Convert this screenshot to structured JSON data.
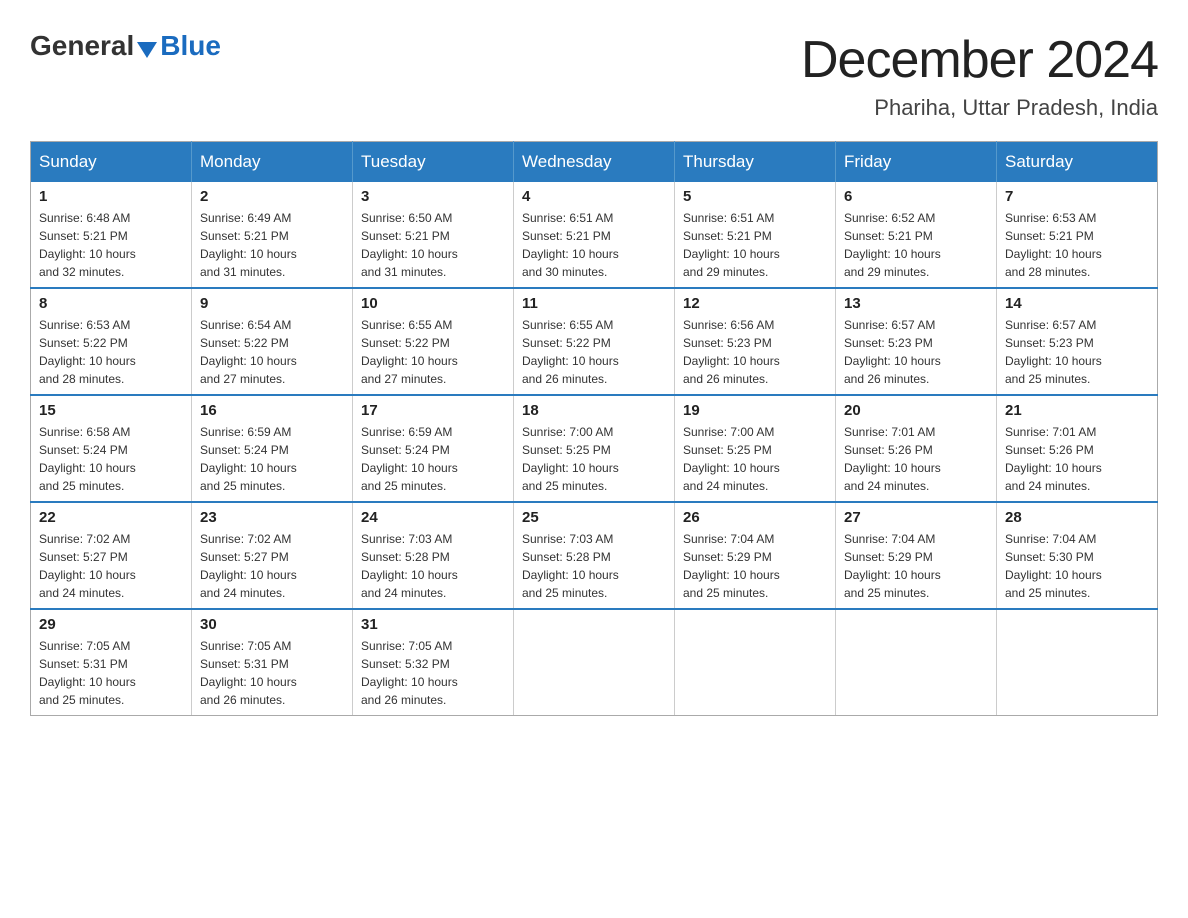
{
  "header": {
    "logo_general": "General",
    "logo_blue": "Blue",
    "month_title": "December 2024",
    "location": "Phariha, Uttar Pradesh, India"
  },
  "days_of_week": [
    "Sunday",
    "Monday",
    "Tuesday",
    "Wednesday",
    "Thursday",
    "Friday",
    "Saturday"
  ],
  "weeks": [
    [
      {
        "day": "1",
        "sunrise": "6:48 AM",
        "sunset": "5:21 PM",
        "daylight": "10 hours and 32 minutes."
      },
      {
        "day": "2",
        "sunrise": "6:49 AM",
        "sunset": "5:21 PM",
        "daylight": "10 hours and 31 minutes."
      },
      {
        "day": "3",
        "sunrise": "6:50 AM",
        "sunset": "5:21 PM",
        "daylight": "10 hours and 31 minutes."
      },
      {
        "day": "4",
        "sunrise": "6:51 AM",
        "sunset": "5:21 PM",
        "daylight": "10 hours and 30 minutes."
      },
      {
        "day": "5",
        "sunrise": "6:51 AM",
        "sunset": "5:21 PM",
        "daylight": "10 hours and 29 minutes."
      },
      {
        "day": "6",
        "sunrise": "6:52 AM",
        "sunset": "5:21 PM",
        "daylight": "10 hours and 29 minutes."
      },
      {
        "day": "7",
        "sunrise": "6:53 AM",
        "sunset": "5:21 PM",
        "daylight": "10 hours and 28 minutes."
      }
    ],
    [
      {
        "day": "8",
        "sunrise": "6:53 AM",
        "sunset": "5:22 PM",
        "daylight": "10 hours and 28 minutes."
      },
      {
        "day": "9",
        "sunrise": "6:54 AM",
        "sunset": "5:22 PM",
        "daylight": "10 hours and 27 minutes."
      },
      {
        "day": "10",
        "sunrise": "6:55 AM",
        "sunset": "5:22 PM",
        "daylight": "10 hours and 27 minutes."
      },
      {
        "day": "11",
        "sunrise": "6:55 AM",
        "sunset": "5:22 PM",
        "daylight": "10 hours and 26 minutes."
      },
      {
        "day": "12",
        "sunrise": "6:56 AM",
        "sunset": "5:23 PM",
        "daylight": "10 hours and 26 minutes."
      },
      {
        "day": "13",
        "sunrise": "6:57 AM",
        "sunset": "5:23 PM",
        "daylight": "10 hours and 26 minutes."
      },
      {
        "day": "14",
        "sunrise": "6:57 AM",
        "sunset": "5:23 PM",
        "daylight": "10 hours and 25 minutes."
      }
    ],
    [
      {
        "day": "15",
        "sunrise": "6:58 AM",
        "sunset": "5:24 PM",
        "daylight": "10 hours and 25 minutes."
      },
      {
        "day": "16",
        "sunrise": "6:59 AM",
        "sunset": "5:24 PM",
        "daylight": "10 hours and 25 minutes."
      },
      {
        "day": "17",
        "sunrise": "6:59 AM",
        "sunset": "5:24 PM",
        "daylight": "10 hours and 25 minutes."
      },
      {
        "day": "18",
        "sunrise": "7:00 AM",
        "sunset": "5:25 PM",
        "daylight": "10 hours and 25 minutes."
      },
      {
        "day": "19",
        "sunrise": "7:00 AM",
        "sunset": "5:25 PM",
        "daylight": "10 hours and 24 minutes."
      },
      {
        "day": "20",
        "sunrise": "7:01 AM",
        "sunset": "5:26 PM",
        "daylight": "10 hours and 24 minutes."
      },
      {
        "day": "21",
        "sunrise": "7:01 AM",
        "sunset": "5:26 PM",
        "daylight": "10 hours and 24 minutes."
      }
    ],
    [
      {
        "day": "22",
        "sunrise": "7:02 AM",
        "sunset": "5:27 PM",
        "daylight": "10 hours and 24 minutes."
      },
      {
        "day": "23",
        "sunrise": "7:02 AM",
        "sunset": "5:27 PM",
        "daylight": "10 hours and 24 minutes."
      },
      {
        "day": "24",
        "sunrise": "7:03 AM",
        "sunset": "5:28 PM",
        "daylight": "10 hours and 24 minutes."
      },
      {
        "day": "25",
        "sunrise": "7:03 AM",
        "sunset": "5:28 PM",
        "daylight": "10 hours and 25 minutes."
      },
      {
        "day": "26",
        "sunrise": "7:04 AM",
        "sunset": "5:29 PM",
        "daylight": "10 hours and 25 minutes."
      },
      {
        "day": "27",
        "sunrise": "7:04 AM",
        "sunset": "5:29 PM",
        "daylight": "10 hours and 25 minutes."
      },
      {
        "day": "28",
        "sunrise": "7:04 AM",
        "sunset": "5:30 PM",
        "daylight": "10 hours and 25 minutes."
      }
    ],
    [
      {
        "day": "29",
        "sunrise": "7:05 AM",
        "sunset": "5:31 PM",
        "daylight": "10 hours and 25 minutes."
      },
      {
        "day": "30",
        "sunrise": "7:05 AM",
        "sunset": "5:31 PM",
        "daylight": "10 hours and 26 minutes."
      },
      {
        "day": "31",
        "sunrise": "7:05 AM",
        "sunset": "5:32 PM",
        "daylight": "10 hours and 26 minutes."
      },
      null,
      null,
      null,
      null
    ]
  ],
  "labels": {
    "sunrise": "Sunrise:",
    "sunset": "Sunset:",
    "daylight": "Daylight:"
  }
}
